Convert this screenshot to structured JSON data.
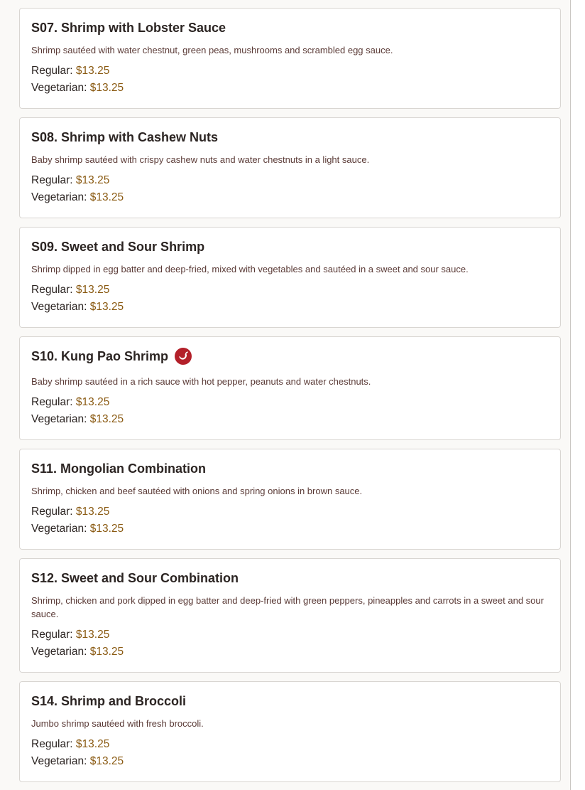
{
  "items": [
    {
      "title": "S07. Shrimp with Lobster Sauce",
      "description": "Shrimp sautéed with water chestnut, green peas, mushrooms and scrambled egg sauce.",
      "regular_label": "Regular:",
      "regular_price": "$13.25",
      "vegetarian_label": "Vegetarian:",
      "vegetarian_price": "$13.25",
      "spicy": false
    },
    {
      "title": "S08. Shrimp with Cashew Nuts",
      "description": "Baby shrimp sautéed with crispy cashew nuts and water chestnuts in a light sauce.",
      "regular_label": "Regular:",
      "regular_price": "$13.25",
      "vegetarian_label": "Vegetarian:",
      "vegetarian_price": "$13.25",
      "spicy": false
    },
    {
      "title": "S09. Sweet and Sour Shrimp",
      "description": "Shrimp dipped in egg batter and deep-fried, mixed with vegetables and sautéed in a sweet and sour sauce.",
      "regular_label": "Regular:",
      "regular_price": "$13.25",
      "vegetarian_label": "Vegetarian:",
      "vegetarian_price": "$13.25",
      "spicy": false
    },
    {
      "title": "S10. Kung Pao Shrimp",
      "description": "Baby shrimp sautéed in a rich sauce with hot pepper, peanuts and water chestnuts.",
      "regular_label": "Regular:",
      "regular_price": "$13.25",
      "vegetarian_label": "Vegetarian:",
      "vegetarian_price": "$13.25",
      "spicy": true,
      "spicy_icon": "chili-pepper-icon"
    },
    {
      "title": "S11. Mongolian Combination",
      "description": "Shrimp, chicken and beef sautéed with onions and spring onions in brown sauce.",
      "regular_label": "Regular:",
      "regular_price": "$13.25",
      "vegetarian_label": "Vegetarian:",
      "vegetarian_price": "$13.25",
      "spicy": false
    },
    {
      "title": "S12. Sweet and Sour Combination",
      "description": "Shrimp, chicken and pork dipped in egg batter and deep-fried with green peppers, pineapples and carrots in a sweet and sour sauce.",
      "regular_label": "Regular:",
      "regular_price": "$13.25",
      "vegetarian_label": "Vegetarian:",
      "vegetarian_price": "$13.25",
      "spicy": false
    },
    {
      "title": "S14. Shrimp and Broccoli",
      "description": "Jumbo shrimp sautéed with fresh broccoli.",
      "regular_label": "Regular:",
      "regular_price": "$13.25",
      "vegetarian_label": "Vegetarian:",
      "vegetarian_price": "$13.25",
      "spicy": false
    }
  ],
  "colors": {
    "title": "#2b2422",
    "description": "#5a3a36",
    "price": "#8a5a12",
    "spicy_icon": "#b3202a",
    "card_border": "#d9d6d2"
  }
}
